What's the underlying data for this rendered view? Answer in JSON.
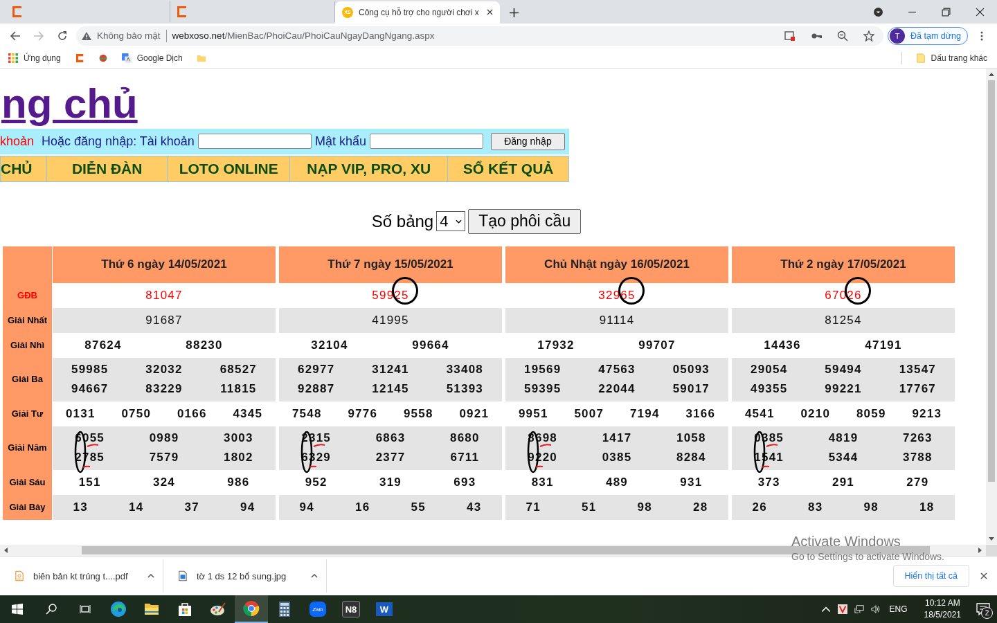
{
  "browser": {
    "tabs": [
      {
        "selected": false,
        "kind": "redacted"
      },
      {
        "selected": false,
        "kind": "redacted"
      },
      {
        "title": "Công cụ hỗ trợ cho người chơi x",
        "selected": true,
        "kind": "site",
        "icon_text": "XS"
      }
    ],
    "security_label": "Không bảo mật",
    "url_host": "webxoso.net",
    "url_path": "/MienBac/PhoiCau/PhoiCauNgayDangNgang.aspx",
    "profile_initial": "T",
    "profile_status": "Đã tạm dừng",
    "bookmarks": [
      {
        "label": "Ứng dụng",
        "kind": "apps"
      },
      {
        "kind": "redacted-c"
      },
      {
        "kind": "redacted-dot"
      },
      {
        "label": "Google Dịch",
        "kind": "translate"
      },
      {
        "kind": "redacted-folder"
      }
    ],
    "other_bookmarks": "Dấu trang khác"
  },
  "page": {
    "heading": "ng chủ",
    "login": {
      "register_link": "khoản",
      "prompt": "Hoặc đăng nhập: Tài khoản",
      "password_label": "Mật khẩu",
      "button": "Đăng nhập"
    },
    "menu": [
      "CHỦ",
      "DIỄN ĐÀN",
      "LOTO ONLINE",
      "NẠP VIP, PRO, XU",
      "SỔ KẾT QUẢ"
    ],
    "table_count_label": "Số bảng",
    "table_count": "4",
    "create_button": "Tạo phôi cầu",
    "row_labels": [
      "GĐB",
      "Giải Nhất",
      "Giải Nhì",
      "Giải Ba",
      "Giải Tư",
      "Giải Năm",
      "Giải Sáu",
      "Giải Bảy"
    ],
    "draws": [
      {
        "title": "Thứ 6 ngày 14/05/2021",
        "gdb": "81047",
        "gdb_circled": false,
        "nhat": "91687",
        "nhi": [
          "87624",
          "88230"
        ],
        "ba": [
          "59985",
          "32032",
          "68527",
          "94667",
          "83229",
          "11815"
        ],
        "tu": [
          "0131",
          "0750",
          "0166",
          "4345"
        ],
        "nam": [
          "6055",
          "0989",
          "3003",
          "2785",
          "7579",
          "1802"
        ],
        "nam_marked": true,
        "sau": [
          "151",
          "324",
          "986"
        ],
        "bay": [
          "13",
          "14",
          "37",
          "94"
        ]
      },
      {
        "title": "Thứ 7 ngày 15/05/2021",
        "gdb": "59925",
        "gdb_circled": true,
        "nhat": "41995",
        "nhi": [
          "32104",
          "99664"
        ],
        "ba": [
          "62977",
          "31241",
          "33408",
          "92887",
          "12145",
          "51393"
        ],
        "tu": [
          "7548",
          "9776",
          "9558",
          "0921"
        ],
        "nam": [
          "2315",
          "6863",
          "8680",
          "6329",
          "2377",
          "6711"
        ],
        "nam_marked": true,
        "sau": [
          "952",
          "319",
          "693"
        ],
        "bay": [
          "94",
          "16",
          "55",
          "43"
        ]
      },
      {
        "title": "Chủ Nhật ngày 16/05/2021",
        "gdb": "32965",
        "gdb_circled": true,
        "nhat": "91114",
        "nhi": [
          "17932",
          "99707"
        ],
        "ba": [
          "19569",
          "47563",
          "05093",
          "59395",
          "22044",
          "59017"
        ],
        "tu": [
          "9951",
          "5007",
          "7194",
          "3166"
        ],
        "nam": [
          "8698",
          "1417",
          "1058",
          "9220",
          "0385",
          "8284"
        ],
        "nam_marked": true,
        "sau": [
          "831",
          "489",
          "931"
        ],
        "bay": [
          "71",
          "51",
          "98",
          "28"
        ]
      },
      {
        "title": "Thứ 2 ngày 17/05/2021",
        "gdb": "67026",
        "gdb_circled": true,
        "nhat": "81254",
        "nhi": [
          "14436",
          "47191"
        ],
        "ba": [
          "29054",
          "59494",
          "13547",
          "49355",
          "99221",
          "17767"
        ],
        "tu": [
          "4541",
          "0210",
          "8059",
          "9213"
        ],
        "nam": [
          "0385",
          "4819",
          "7263",
          "1541",
          "5344",
          "3788"
        ],
        "nam_marked": true,
        "sau": [
          "373",
          "291",
          "279"
        ],
        "bay": [
          "26",
          "83",
          "98",
          "18"
        ]
      }
    ]
  },
  "activation": {
    "title": "Activate Windows",
    "subtitle": "Go to Settings to activate Windows."
  },
  "downloads": {
    "items": [
      {
        "name": "biên bản kt trúng t....pdf",
        "kind": "pdf"
      },
      {
        "name": "tờ 1 ds 12 bổ sung.jpg",
        "kind": "image"
      }
    ],
    "show_all": "Hiển thị tất cả"
  },
  "taskbar": {
    "apps": [
      {
        "kind": "edge",
        "active": false
      },
      {
        "kind": "explorer",
        "active": false
      },
      {
        "kind": "store",
        "active": false
      },
      {
        "kind": "paint",
        "active": false
      },
      {
        "kind": "chrome",
        "active": true
      },
      {
        "kind": "calculator",
        "active": false
      },
      {
        "kind": "zalo",
        "active": false
      },
      {
        "kind": "n8",
        "active": false
      },
      {
        "kind": "word",
        "active": false
      }
    ],
    "language": "ENG",
    "time": "10:12 AM",
    "date": "18/5/2021",
    "notifications": "2",
    "zalo_text": "Zalo",
    "n8_text": "N8",
    "word_text": "W"
  }
}
